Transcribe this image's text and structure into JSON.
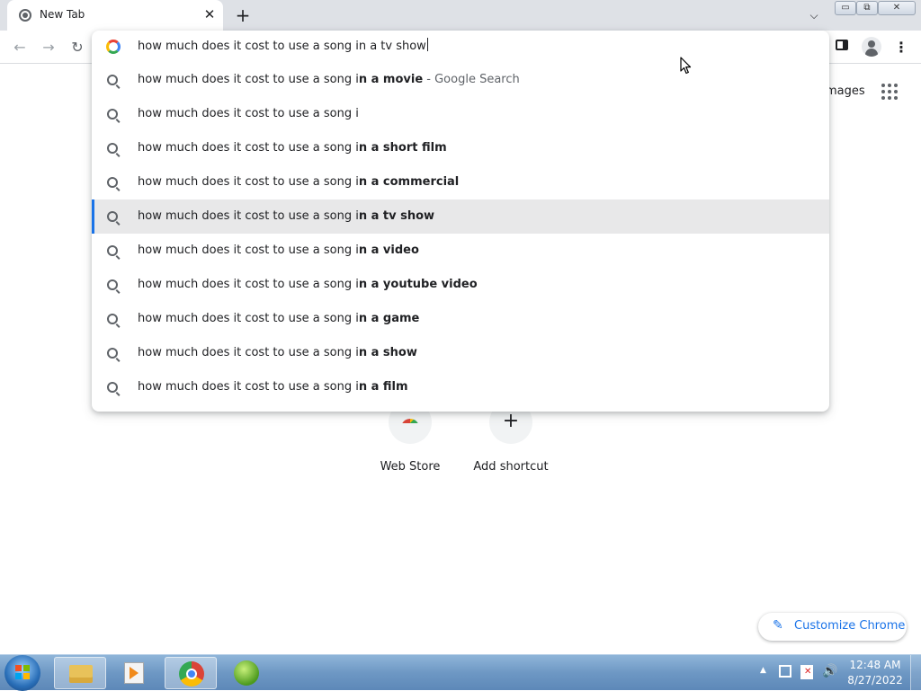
{
  "tab": {
    "title": "New Tab",
    "close_glyph": "✕"
  },
  "new_tab_glyph": "+",
  "tab_search_glyph": "⌵",
  "window_controls": {
    "minimize": "▭",
    "maximize": "⧉",
    "close": "✕"
  },
  "toolbar": {
    "back": "←",
    "forward": "→",
    "reload": "↻",
    "menu": "⋮"
  },
  "omnibox": {
    "input_value": "how much does it cost to use a song in a tv show",
    "suggestions": [
      {
        "prefix": "how much does it cost to use a song i",
        "completion": "n a movie",
        "description": " - Google Search",
        "selected": false
      },
      {
        "prefix": "how much does it cost to use a song i",
        "completion": "",
        "description": "",
        "selected": false
      },
      {
        "prefix": "how much does it cost to use a song i",
        "completion": "n a short film",
        "description": "",
        "selected": false
      },
      {
        "prefix": "how much does it cost to use a song i",
        "completion": "n a commercial",
        "description": "",
        "selected": false
      },
      {
        "prefix": "how much does it cost to use a song i",
        "completion": "n a tv show",
        "description": "",
        "selected": true
      },
      {
        "prefix": "how much does it cost to use a song i",
        "completion": "n a video",
        "description": "",
        "selected": false
      },
      {
        "prefix": "how much does it cost to use a song i",
        "completion": "n a youtube video",
        "description": "",
        "selected": false
      },
      {
        "prefix": "how much does it cost to use a song i",
        "completion": "n a game",
        "description": "",
        "selected": false
      },
      {
        "prefix": "how much does it cost to use a song i",
        "completion": "n a show",
        "description": "",
        "selected": false
      },
      {
        "prefix": "how much does it cost to use a song i",
        "completion": "n a film",
        "description": "",
        "selected": false
      }
    ]
  },
  "ntp": {
    "images_link": "mages",
    "shortcuts": [
      {
        "label": "Web Store"
      },
      {
        "label": "Add shortcut",
        "glyph": "+"
      }
    ],
    "customize": {
      "icon": "✎",
      "label": "Customize Chrome"
    }
  },
  "taskbar": {
    "tray_arrow": "▲",
    "volume_glyph": "🔊",
    "clock": {
      "time": "12:48 AM",
      "date": "8/27/2022"
    }
  },
  "colors": {
    "accent": "#1a73e8",
    "selected_row": "#e8e8e9",
    "tabstrip": "#dee1e6"
  }
}
